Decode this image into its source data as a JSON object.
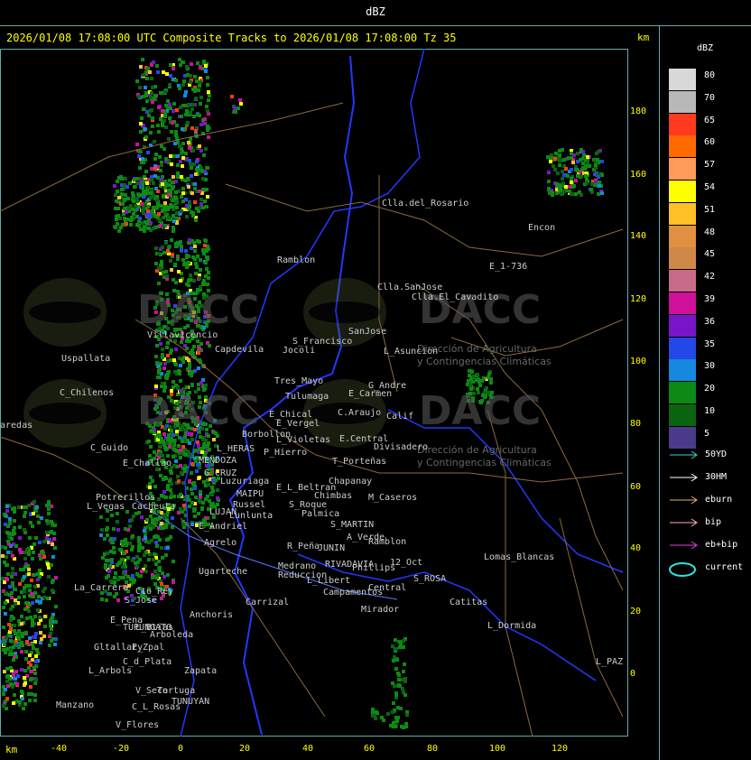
{
  "top_title": "dBZ",
  "header": "2026/01/08 17:08:00 UTC Composite Tracks to 2026/01/08 17:08:00 Tz 35",
  "km_label": "km",
  "y_ticks": [
    "180",
    "160",
    "140",
    "120",
    "100",
    "80",
    "60",
    "40",
    "20",
    "0"
  ],
  "x_ticks": [
    "-40",
    "-20",
    "0",
    "20",
    "40",
    "60",
    "80",
    "100",
    "120"
  ],
  "legend": {
    "title": "dBZ",
    "levels": [
      {
        "label": "80",
        "color": "#d8d8d8"
      },
      {
        "label": "70",
        "color": "#b8b8b8"
      },
      {
        "label": "65",
        "color": "#ff3a1e"
      },
      {
        "label": "60",
        "color": "#ff6a00"
      },
      {
        "label": "57",
        "color": "#ff9a5a"
      },
      {
        "label": "54",
        "color": "#ffff00"
      },
      {
        "label": "51",
        "color": "#ffc028"
      },
      {
        "label": "48",
        "color": "#e09040"
      },
      {
        "label": "45",
        "color": "#d08848"
      },
      {
        "label": "42",
        "color": "#c86a8a"
      },
      {
        "label": "39",
        "color": "#d0109a"
      },
      {
        "label": "36",
        "color": "#7a14c8"
      },
      {
        "label": "35",
        "color": "#2448e8"
      },
      {
        "label": "30",
        "color": "#1688e0"
      },
      {
        "label": "20",
        "color": "#0c8a14"
      },
      {
        "label": "10",
        "color": "#0a6410"
      },
      {
        "label": "5",
        "color": "#4a3a8a"
      }
    ],
    "tracks": [
      {
        "label": "50YD",
        "color": "#3fd0d0"
      },
      {
        "label": "30HM",
        "color": "#ffffff"
      },
      {
        "label": "eburn",
        "color": "#e8b070"
      },
      {
        "label": "bip",
        "color": "#ffb0c0"
      },
      {
        "label": "eb+bip",
        "color": "#e040e0"
      },
      {
        "label": "current",
        "color": "#30e0e0"
      }
    ]
  },
  "watermark": {
    "brand": "DACC",
    "line1": "Dirección de Agricultura",
    "line2": "y Contingencias Climáticas"
  },
  "places": [
    {
      "name": "Clla.del_Rosario"
    },
    {
      "name": "Encon"
    },
    {
      "name": "E_1-736"
    },
    {
      "name": "Ramblon"
    },
    {
      "name": "Clla.SanJose"
    },
    {
      "name": "Clla.El_Cavadito"
    },
    {
      "name": "Villavicencio"
    },
    {
      "name": "Uspallata"
    },
    {
      "name": "Capdevila"
    },
    {
      "name": "S_Francisco"
    },
    {
      "name": "Jocoli"
    },
    {
      "name": "SanJose"
    },
    {
      "name": "L_Asuncion"
    },
    {
      "name": "C_Chilenos"
    },
    {
      "name": "Tres_Mayo"
    },
    {
      "name": "G_Andre"
    },
    {
      "name": "Tulumaga"
    },
    {
      "name": "E_Carmen"
    },
    {
      "name": "E_Chical"
    },
    {
      "name": "C.Araujo"
    },
    {
      "name": "Calif"
    },
    {
      "name": "E_Vergel"
    },
    {
      "name": "Borbollon"
    },
    {
      "name": "E.Central"
    },
    {
      "name": "L_Violetas"
    },
    {
      "name": "Divisadero"
    },
    {
      "name": "C_Guido"
    },
    {
      "name": "L_HERAS"
    },
    {
      "name": "P_Hierro"
    },
    {
      "name": "E_Challao"
    },
    {
      "name": "MENDOZA"
    },
    {
      "name": "T_Porteñas"
    },
    {
      "name": "G_CRUZ"
    },
    {
      "name": "Chapanay"
    },
    {
      "name": "Luzuriaga"
    },
    {
      "name": "E_L_Beltran"
    },
    {
      "name": "MAIPU"
    },
    {
      "name": "Chimbas"
    },
    {
      "name": "M_Caseros"
    },
    {
      "name": "Potrerillos"
    },
    {
      "name": "Russel"
    },
    {
      "name": "S_Roque"
    },
    {
      "name": "L_Vegas"
    },
    {
      "name": "Cacheuta"
    },
    {
      "name": "LUJAN"
    },
    {
      "name": "Lunlunta"
    },
    {
      "name": "Palmica"
    },
    {
      "name": "S_MARTIN"
    },
    {
      "name": "E_Andriel"
    },
    {
      "name": "A_Verde"
    },
    {
      "name": "Ramblon"
    },
    {
      "name": "R_Peña"
    },
    {
      "name": "JUNIN"
    },
    {
      "name": "Agrelo"
    },
    {
      "name": "Lomas_Blancas"
    },
    {
      "name": "Medrano"
    },
    {
      "name": "RIVADAVIA"
    },
    {
      "name": "Phillips"
    },
    {
      "name": "12_Oct"
    },
    {
      "name": "Ugarteche"
    },
    {
      "name": "Reduccion"
    },
    {
      "name": "L_Libert"
    },
    {
      "name": "S_ROSA"
    },
    {
      "name": "La_Carrera"
    },
    {
      "name": "Cto_Rey"
    },
    {
      "name": "Campamentos"
    },
    {
      "name": "Central"
    },
    {
      "name": "S_Jose"
    },
    {
      "name": "Carrizal"
    },
    {
      "name": "Catitas"
    },
    {
      "name": "Anchoris"
    },
    {
      "name": "Mirador"
    },
    {
      "name": "E_Pena"
    },
    {
      "name": "L_Btias"
    },
    {
      "name": "TUPUNGATO"
    },
    {
      "name": "L_Dormida"
    },
    {
      "name": "Arboleda"
    },
    {
      "name": "Gltallary"
    },
    {
      "name": "E_Zpal"
    },
    {
      "name": "C_d_Plata"
    },
    {
      "name": "L_Arbols"
    },
    {
      "name": "Zapata"
    },
    {
      "name": "L_PAZ"
    },
    {
      "name": "V_Seca"
    },
    {
      "name": "Tortuga"
    },
    {
      "name": "TUNUYAN"
    },
    {
      "name": "Manzano"
    },
    {
      "name": "C_L_Rosas"
    },
    {
      "name": "V_Flores"
    },
    {
      "name": "aredas"
    }
  ]
}
